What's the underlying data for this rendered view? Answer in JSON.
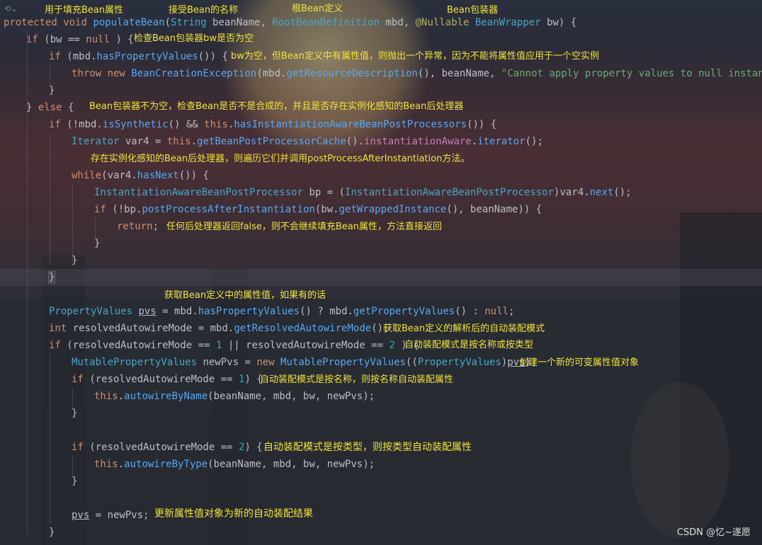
{
  "editor": {
    "gutter_icon": "fold-icon",
    "gutter_glyph": "⟲⌄",
    "code_lines": [
      {
        "id": "l0",
        "tokens": [
          [
            "kw",
            "protected void "
          ],
          [
            "fn",
            "populateBean"
          ],
          [
            "",
            "("
          ],
          [
            "ty",
            "String"
          ],
          [
            "",
            " beanName, "
          ],
          [
            "ty",
            "RootBeanDefinition"
          ],
          [
            "",
            " mbd, "
          ],
          [
            "an",
            "@Nullable "
          ],
          [
            "ty",
            "BeanWrapper"
          ],
          [
            "",
            " bw) {"
          ]
        ]
      },
      {
        "id": "l1",
        "tokens": [
          [
            "kw",
            "if"
          ],
          [
            "",
            " (bw == "
          ],
          [
            "kw",
            "null"
          ],
          [
            "",
            " ) {"
          ]
        ]
      },
      {
        "id": "l2",
        "tokens": [
          [
            "kw",
            "if"
          ],
          [
            "",
            " (mbd."
          ],
          [
            "fn",
            "hasPropertyValues"
          ],
          [
            "",
            "()) {"
          ]
        ]
      },
      {
        "id": "l3",
        "tokens": [
          [
            "kw",
            "throw new "
          ],
          [
            "fn",
            "BeanCreationException"
          ],
          [
            "",
            "(mbd."
          ],
          [
            "fn",
            "getResourceDescription"
          ],
          [
            "",
            "(), beanName, "
          ],
          [
            "str",
            "\"Cannot apply property values to null instance\""
          ],
          [
            "",
            ");"
          ]
        ]
      },
      {
        "id": "l4",
        "tokens": [
          [
            "",
            "}"
          ]
        ]
      },
      {
        "id": "l5",
        "tokens": [
          [
            "",
            "} "
          ],
          [
            "kw",
            "else"
          ],
          [
            "",
            " {"
          ]
        ]
      },
      {
        "id": "l6",
        "tokens": [
          [
            "kw",
            "if"
          ],
          [
            "",
            " (!mbd."
          ],
          [
            "fn",
            "isSynthetic"
          ],
          [
            "",
            "() && "
          ],
          [
            "kw",
            "this"
          ],
          [
            "",
            "."
          ],
          [
            "fn",
            "hasInstantiationAwareBeanPostProcessors"
          ],
          [
            "",
            "()) {"
          ]
        ]
      },
      {
        "id": "l7",
        "tokens": [
          [
            "ty",
            "Iterator"
          ],
          [
            "",
            " var4 = "
          ],
          [
            "kw",
            "this"
          ],
          [
            "",
            "."
          ],
          [
            "fn",
            "getBeanPostProcessorCache"
          ],
          [
            "",
            "()."
          ],
          [
            "fld",
            "instantiationAware"
          ],
          [
            "",
            "."
          ],
          [
            "fn",
            "iterator"
          ],
          [
            "",
            "();"
          ]
        ]
      },
      {
        "id": "l8",
        "tokens": [
          [
            "kw",
            "while"
          ],
          [
            "",
            "(var4."
          ],
          [
            "fn",
            "hasNext"
          ],
          [
            "",
            "()) {"
          ]
        ]
      },
      {
        "id": "l9",
        "tokens": [
          [
            "ty",
            "InstantiationAwareBeanPostProcessor"
          ],
          [
            "",
            " bp = ("
          ],
          [
            "ty",
            "InstantiationAwareBeanPostProcessor"
          ],
          [
            "",
            ")var4."
          ],
          [
            "fn",
            "next"
          ],
          [
            "",
            "();"
          ]
        ]
      },
      {
        "id": "l10",
        "tokens": [
          [
            "kw",
            "if"
          ],
          [
            "",
            " (!bp."
          ],
          [
            "fn",
            "postProcessAfterInstantiation"
          ],
          [
            "",
            "(bw."
          ],
          [
            "fn",
            "getWrappedInstance"
          ],
          [
            "",
            "(), beanName)) {"
          ]
        ]
      },
      {
        "id": "l11",
        "tokens": [
          [
            "kw",
            "return"
          ],
          [
            "",
            ";"
          ]
        ]
      },
      {
        "id": "l12",
        "tokens": [
          [
            "",
            "}"
          ]
        ]
      },
      {
        "id": "l13",
        "tokens": [
          [
            "",
            "}"
          ]
        ]
      },
      {
        "id": "l14",
        "tokens": [
          [
            "",
            "}"
          ]
        ]
      },
      {
        "id": "l15",
        "tokens": [
          [
            "ty",
            "PropertyValues"
          ],
          [
            "",
            " "
          ],
          [
            "under",
            "pvs"
          ],
          [
            "",
            " = mbd."
          ],
          [
            "fn",
            "hasPropertyValues"
          ],
          [
            "",
            "() ? mbd."
          ],
          [
            "fn",
            "getPropertyValues"
          ],
          [
            "",
            "() : "
          ],
          [
            "kw",
            "null"
          ],
          [
            "",
            ";"
          ]
        ]
      },
      {
        "id": "l16",
        "tokens": [
          [
            "kw",
            "int"
          ],
          [
            "",
            " resolvedAutowireMode = mbd."
          ],
          [
            "fn",
            "getResolvedAutowireMode"
          ],
          [
            "",
            "();"
          ]
        ]
      },
      {
        "id": "l17",
        "tokens": [
          [
            "kw",
            "if"
          ],
          [
            "",
            " (resolvedAutowireMode == "
          ],
          [
            "num",
            "1"
          ],
          [
            "",
            " || resolvedAutowireMode == "
          ],
          [
            "num",
            "2"
          ],
          [
            "",
            " ) {"
          ]
        ]
      },
      {
        "id": "l18",
        "tokens": [
          [
            "ty",
            "MutablePropertyValues"
          ],
          [
            "",
            " newPvs = "
          ],
          [
            "kw",
            "new "
          ],
          [
            "fn",
            "MutablePropertyValues"
          ],
          [
            "",
            "(("
          ],
          [
            "ty",
            "PropertyValues"
          ],
          [
            "",
            ")"
          ],
          [
            "under",
            "pvs"
          ],
          [
            "",
            ");"
          ]
        ]
      },
      {
        "id": "l19",
        "tokens": [
          [
            "kw",
            "if"
          ],
          [
            "",
            " (resolvedAutowireMode == "
          ],
          [
            "num",
            "1"
          ],
          [
            "",
            ") {"
          ]
        ]
      },
      {
        "id": "l20",
        "tokens": [
          [
            "kw",
            "this"
          ],
          [
            "",
            "."
          ],
          [
            "fn",
            "autowireByName"
          ],
          [
            "",
            "(beanName, mbd, bw, newPvs);"
          ]
        ]
      },
      {
        "id": "l21",
        "tokens": [
          [
            "",
            "}"
          ]
        ]
      },
      {
        "id": "l22",
        "tokens": [
          [
            "kw",
            "if"
          ],
          [
            "",
            " (resolvedAutowireMode == "
          ],
          [
            "num",
            "2"
          ],
          [
            "",
            ") {"
          ]
        ]
      },
      {
        "id": "l23",
        "tokens": [
          [
            "kw",
            "this"
          ],
          [
            "",
            "."
          ],
          [
            "fn",
            "autowireByType"
          ],
          [
            "",
            "(beanName, mbd, bw, newPvs);"
          ]
        ]
      },
      {
        "id": "l24",
        "tokens": [
          [
            "",
            "}"
          ]
        ]
      },
      {
        "id": "l25",
        "tokens": [
          [
            "under",
            "pvs"
          ],
          [
            "",
            " = newPvs;"
          ]
        ]
      },
      {
        "id": "l26",
        "tokens": [
          [
            "",
            "}"
          ]
        ]
      }
    ]
  },
  "annotations": {
    "fill_bean_props": "用于填充Bean属性",
    "bean_name": "接受Bean的名称",
    "root_def": "根Bean定义",
    "bean_wrapper": "Bean包装器",
    "check_bw_null": "检查Bean包装器bw是否为空",
    "bw_null_throw": "bw为空，但Bean定义中有属性值，则抛出一个异常，因为不能将属性值应用于一个空实例",
    "bw_not_null": "Bean包装器不为空，检查Bean是否不是合成的，并且是否存在实例化感知的Bean后处理器",
    "iterate_processors": "存在实例化感知的Bean后处理器，则遍历它们并调用postProcessAfterInstantiation方法。",
    "return_false": "任何后处理器返回false，则不会继续填充Bean属性，方法直接返回",
    "get_prop_values": "获取Bean定义中的属性值，如果有的话",
    "get_autowire_mode": "获取Bean定义的解析后的自动装配模式",
    "by_name_or_type": "自动装配模式是按名称或按类型",
    "new_mutable": "创建一个新的可变属性值对象",
    "by_name": "自动装配模式是按名称，则按名称自动装配属性",
    "by_type": "自动装配模式是按类型，则按类型自动装配属性",
    "update_pvs": "更新属性值对象为新的自动装配结果"
  },
  "watermark": "CSDN @忆~遂愿",
  "colors": {
    "keyword": "#cf8e6d",
    "method": "#56a8f5",
    "type": "#4aa6c8",
    "string": "#6aab73",
    "number": "#2aacb8",
    "annotation": "#b3ae60",
    "comment_overlay": "#f2e33a"
  }
}
